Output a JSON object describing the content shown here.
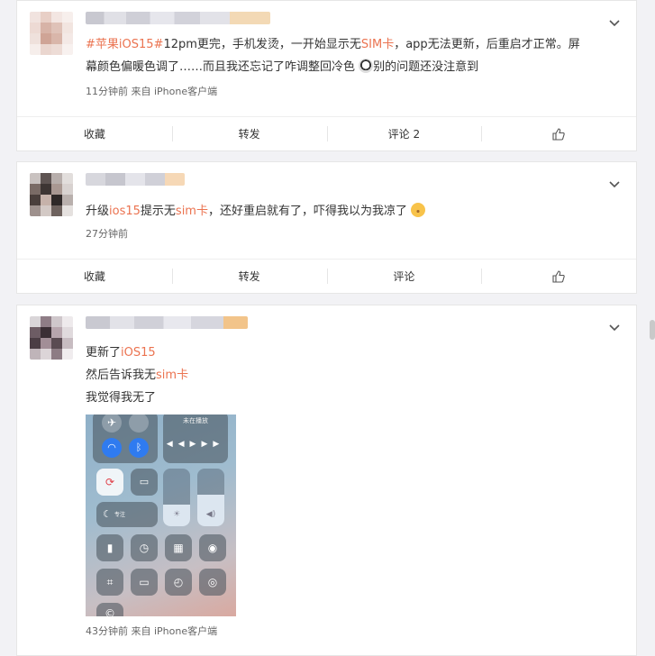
{
  "posts": [
    {
      "text_parts": {
        "tag": "#苹果iOS15#",
        "a": "12pm更完，手机发烫，一开始显示无",
        "hl1": "SIM卡",
        "b": "，app无法更新，后重启才正常。屏",
        "line2a": "幕颜色偏暖色调了……而且我还忘记了咋调整回冷色",
        "line2b": "别的问题还没注意到"
      },
      "meta": "11分钟前  来自 iPhone客户端",
      "actions": {
        "collect": "收藏",
        "repost": "转发",
        "comment": "评论 2"
      }
    },
    {
      "text_parts": {
        "a": "升级",
        "hl1": "ios15",
        "b": "提示无",
        "hl2": "sim卡",
        "c": "，还好重启就有了，吓得我以为我凉了"
      },
      "meta": "27分钟前",
      "actions": {
        "collect": "收藏",
        "repost": "转发",
        "comment": "评论"
      }
    },
    {
      "line1a": "更新了",
      "line1hl": "iOS15",
      "line2a": "然后告诉我无",
      "line2hl": "sim卡",
      "line3": "我觉得我无了",
      "image": {
        "now_playing": "未在播放",
        "focus": "专注"
      },
      "meta": "43分钟前  来自 iPhone客户端"
    }
  ],
  "colors": {
    "highlight": "#eb7350",
    "link": "#eb7350"
  },
  "icons": [
    "chevron-down-icon",
    "like-icon"
  ]
}
